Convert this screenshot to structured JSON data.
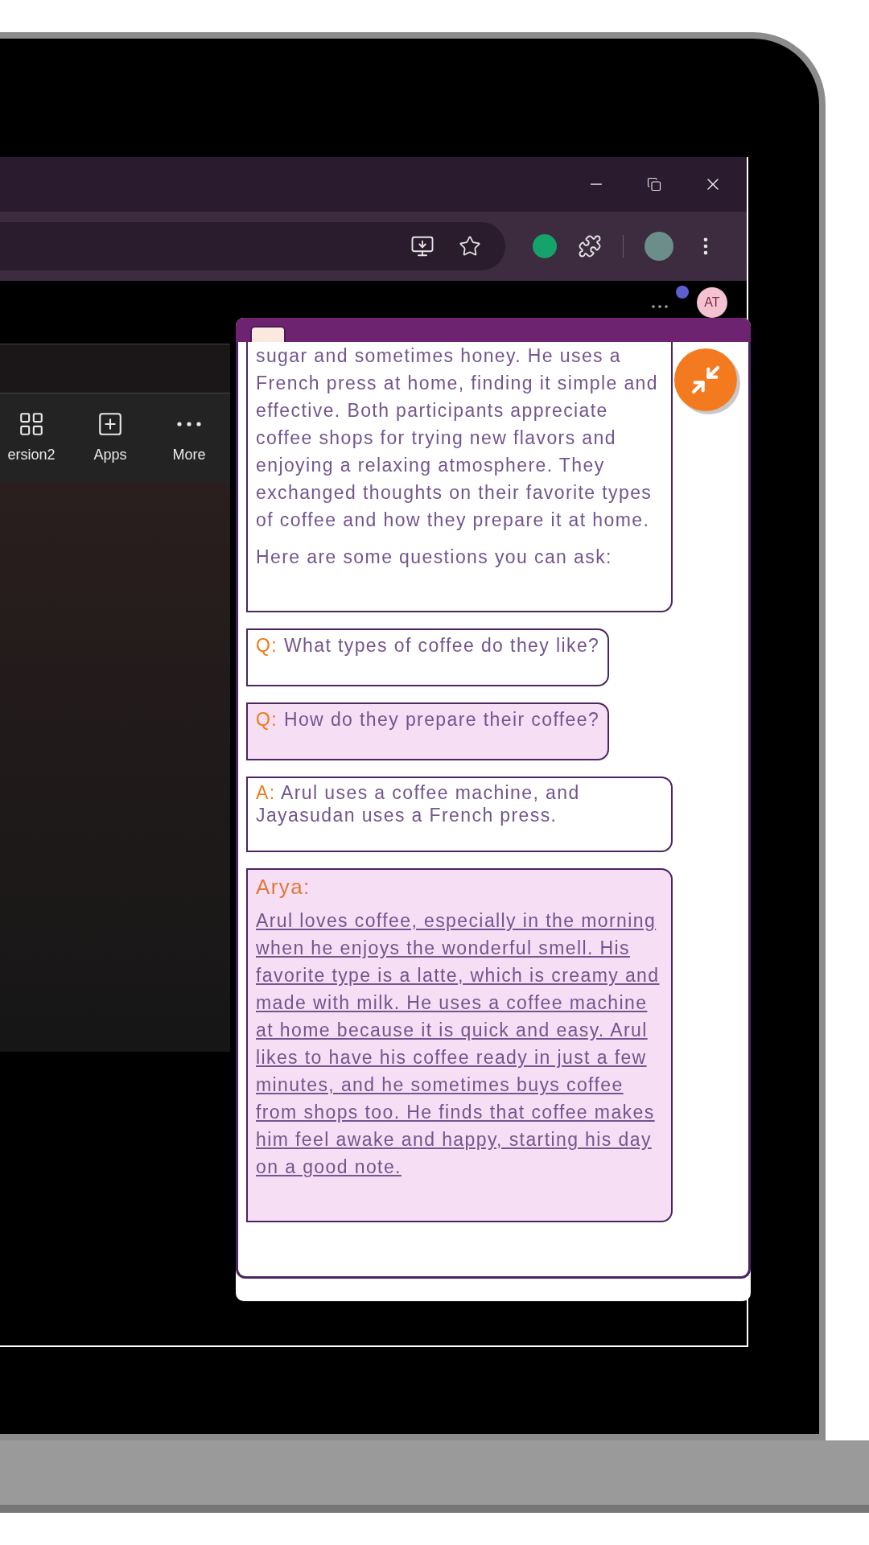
{
  "page": {
    "avatar": "AT",
    "ribbon": [
      {
        "kind": "grid",
        "label": "ersion2"
      },
      {
        "kind": "plus",
        "label": "Apps"
      },
      {
        "kind": "more",
        "label": "More"
      }
    ]
  },
  "chat": {
    "summary": [
      "sugar and sometimes honey. He uses a French press at home, finding it simple and effective. Both participants appreciate coffee shops for trying new flavors and enjoying a relaxing atmosphere. They exchanged thoughts on their favorite types of coffee and how they prepare it at home.",
      "Here are some questions you can ask:"
    ],
    "questions": [
      {
        "prefix": "Q:",
        "text": "What types of coffee do they like?",
        "selected": false
      },
      {
        "prefix": "Q:",
        "text": "How do they prepare their coffee?",
        "selected": true
      }
    ],
    "answer": {
      "prefix": "A:",
      "text": "Arul uses a coffee machine, and Jayasudan uses a French press."
    },
    "response": {
      "speaker": "Arya:",
      "text": "Arul loves coffee, especially in the morning when he enjoys the wonderful smell. His favorite type is a latte, which is creamy and made with milk. He uses a coffee machine at home because it is quick and easy. Arul likes to have his coffee ready in just a few minutes, and he sometimes buys coffee from shops too. He finds that coffee makes him feel awake and happy, starting his day on a good note."
    }
  }
}
